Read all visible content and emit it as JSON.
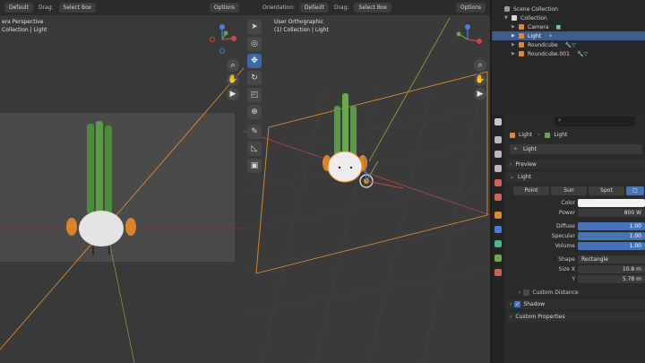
{
  "left_viewport": {
    "header": {
      "interaction": "Default",
      "drag_label": "Drag:",
      "select_box": "Select Box",
      "options": "Options"
    },
    "overlay_line1": "era Perspective",
    "overlay_line2": "Collection | Light"
  },
  "mid_viewport": {
    "header": {
      "orientation_label": "Orientation:",
      "orientation": "Default",
      "drag_label": "Drag:",
      "select_box": "Select Box",
      "options": "Options"
    },
    "overlay_line1": "User Orthographic",
    "overlay_line2": "(1) Collection | Light"
  },
  "outliner": {
    "items": [
      {
        "label": "Scene Collection",
        "icon_color": "#9a9a9a"
      },
      {
        "label": "Collection",
        "icon_color": "#d8d8d8"
      },
      {
        "label": "Camera",
        "icon_color": "#d9893a"
      },
      {
        "label": "Light",
        "icon_color": "#d9893a"
      },
      {
        "label": "Roundcube",
        "icon_color": "#d9893a"
      },
      {
        "label": "Roundcube.001",
        "icon_color": "#d9893a"
      }
    ]
  },
  "properties": {
    "breadcrumb": {
      "object": "Light",
      "data": "Light"
    },
    "data_name": "Light",
    "panel_preview": "Preview",
    "panel_light": "Light",
    "light_types": [
      "Point",
      "Sun",
      "Spot"
    ],
    "color_label": "Color",
    "power_label": "Power",
    "power_value": "800 W",
    "diffuse_label": "Diffuse",
    "diffuse_value": "1.00",
    "specular_label": "Specular",
    "specular_value": "1.00",
    "volume_label": "Volume",
    "volume_value": "1.00",
    "shape_label": "Shape",
    "shape_value": "Rectangle",
    "sizex_label": "Size X",
    "sizex_value": "10.8 m",
    "y_label": "Y",
    "y_value": "5.78 m",
    "custom_distance": "Custom Distance",
    "shadow": "Shadow",
    "custom_properties": "Custom Properties"
  },
  "colors": {
    "accent": "#4772b3",
    "selection_orange": "#e88a2a"
  }
}
